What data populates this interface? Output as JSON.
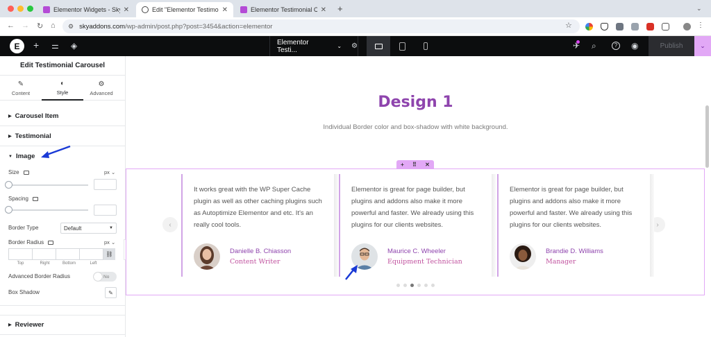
{
  "browser": {
    "tabs": [
      {
        "title": "Elementor Widgets - Sky Addo",
        "active": false,
        "favicon_color": "#b44bd6"
      },
      {
        "title": "Edit \"Elementor Testimonial C",
        "active": true,
        "favicon_color": "#444444"
      },
      {
        "title": "Elementor Testimonial Carous",
        "active": false,
        "favicon_color": "#b44bd6"
      }
    ],
    "new_tab": "+",
    "close_glyph": "✕",
    "url_host": "skyaddons.com",
    "url_path": "/wp-admin/post.php?post=3454&action=elementor"
  },
  "editor": {
    "logo": "E",
    "document_title": "Elementor Testi...",
    "publish_label": "Publish"
  },
  "panel": {
    "title": "Edit Testimonial Carousel",
    "tabs": [
      {
        "label": "Content",
        "icon": "pencil-icon",
        "glyph": "✎"
      },
      {
        "label": "Style",
        "icon": "contrast-icon",
        "glyph": "◐"
      },
      {
        "label": "Advanced",
        "icon": "gear-icon",
        "glyph": "⚙"
      }
    ],
    "sections": {
      "carousel_item": "Carousel Item",
      "testimonial": "Testimonial",
      "image": "Image",
      "reviewer": "Reviewer"
    },
    "controls": {
      "size_label": "Size",
      "spacing_label": "Spacing",
      "unit_px": "px ⌄",
      "border_type_label": "Border Type",
      "border_type_value": "Default",
      "border_radius_label": "Border Radius",
      "dim_labels": [
        "Top",
        "Right",
        "Bottom",
        "Left"
      ],
      "advanced_border_radius_label": "Advanced Border Radius",
      "toggle_value": "No",
      "box_shadow_label": "Box Shadow"
    }
  },
  "canvas": {
    "heading": "Design 1",
    "subheading": "Individual Border color and box-shadow with white background.",
    "testimonials": [
      {
        "text": "It works great with the WP Super Cache plugin as well as other caching plugins such as Autoptimize Elementor and etc. It's an really cool tools.",
        "name": "Danielle B. Chiasson",
        "role": "Content Writer"
      },
      {
        "text": "Elementor is great for page builder, but plugins and addons also make it more powerful and faster. We already using this plugins for our clients websites.",
        "name": "Maurice C. Wheeler",
        "role": "Equipment Technician"
      },
      {
        "text": "Elementor is great for page builder, but plugins and addons also make it more powerful and faster. We already using this plugins for our clients websites.",
        "name": "Brandie D. Williams",
        "role": "Manager"
      }
    ],
    "dots_count": 6,
    "active_dot": 2
  },
  "colors": {
    "accent": "#8e44ad",
    "role": "#c0519e",
    "card_border": "#d1a4e6",
    "annotation_arrow": "#1a3ad6"
  }
}
